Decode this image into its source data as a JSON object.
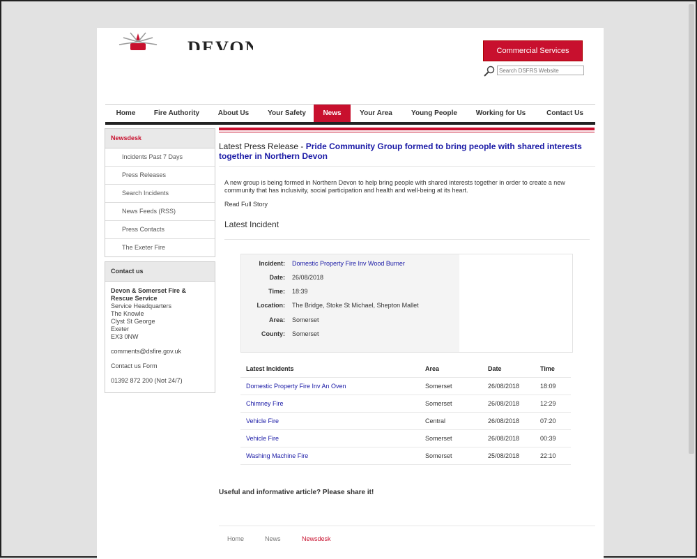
{
  "header": {
    "logo_text": "DEVON &",
    "commercial_label": "Commercial Services",
    "search_placeholder": "Search DSFRS Website",
    "colors": {
      "brand_red": "#c8102e",
      "link_blue": "#1a1aa6"
    }
  },
  "nav": {
    "items": [
      "Home",
      "Fire Authority",
      "About Us",
      "Your Safety",
      "News",
      "Your Area",
      "Young People",
      "Working for Us",
      "Contact Us"
    ],
    "active": "News"
  },
  "sidebar": {
    "newsdesk_title": "Newsdesk",
    "items": [
      "Incidents Past 7 Days",
      "Press Releases",
      "Search Incidents",
      "News Feeds (RSS)",
      "Press Contacts",
      "The Exeter Fire"
    ],
    "contact_title": "Contact us",
    "contact_name": "Devon & Somerset Fire & Rescue Service",
    "address": [
      "Service Headquarters",
      "The Knowle",
      "Clyst St George",
      "Exeter",
      "EX3 0NW"
    ],
    "email": "comments@dsfire.gov.uk",
    "form_link": "Contact us Form",
    "phone": "01392 872 200 (Not 24/7)"
  },
  "press": {
    "prefix": "Latest Press Release -",
    "title": "Pride Community Group formed to bring people with shared interests together in Northern Devon",
    "summary": "A new group is being formed in Northern Devon to help bring people with shared interests together in order to create a new community that has inclusivity, social participation and health and well-being at its heart.",
    "read_more": "Read Full Story"
  },
  "latest_incident": {
    "heading": "Latest Incident",
    "labels": {
      "incident": "Incident:",
      "date": "Date:",
      "time": "Time:",
      "location": "Location:",
      "area": "Area:",
      "county": "County:"
    },
    "incident": "Domestic Property Fire Inv Wood Burner",
    "date": "26/08/2018",
    "time": "18:39",
    "location": "The Bridge, Stoke St Michael, Shepton Mallet",
    "area": "Somerset",
    "county": "Somerset"
  },
  "incidents_table": {
    "headers": [
      "Latest Incidents",
      "Area",
      "Date",
      "Time"
    ],
    "rows": [
      [
        "Domestic Property Fire Inv An Oven",
        "Somerset",
        "26/08/2018",
        "18:09"
      ],
      [
        "Chimney Fire",
        "Somerset",
        "26/08/2018",
        "12:29"
      ],
      [
        "Vehicle Fire",
        "Central",
        "26/08/2018",
        "07:20"
      ],
      [
        "Vehicle Fire",
        "Somerset",
        "26/08/2018",
        "00:39"
      ],
      [
        "Washing Machine Fire",
        "Somerset",
        "25/08/2018",
        "22:10"
      ]
    ]
  },
  "share_text": "Useful and informative article? Please share it!",
  "footer": {
    "crumbs": [
      "Home",
      "News",
      "Newsdesk"
    ]
  }
}
